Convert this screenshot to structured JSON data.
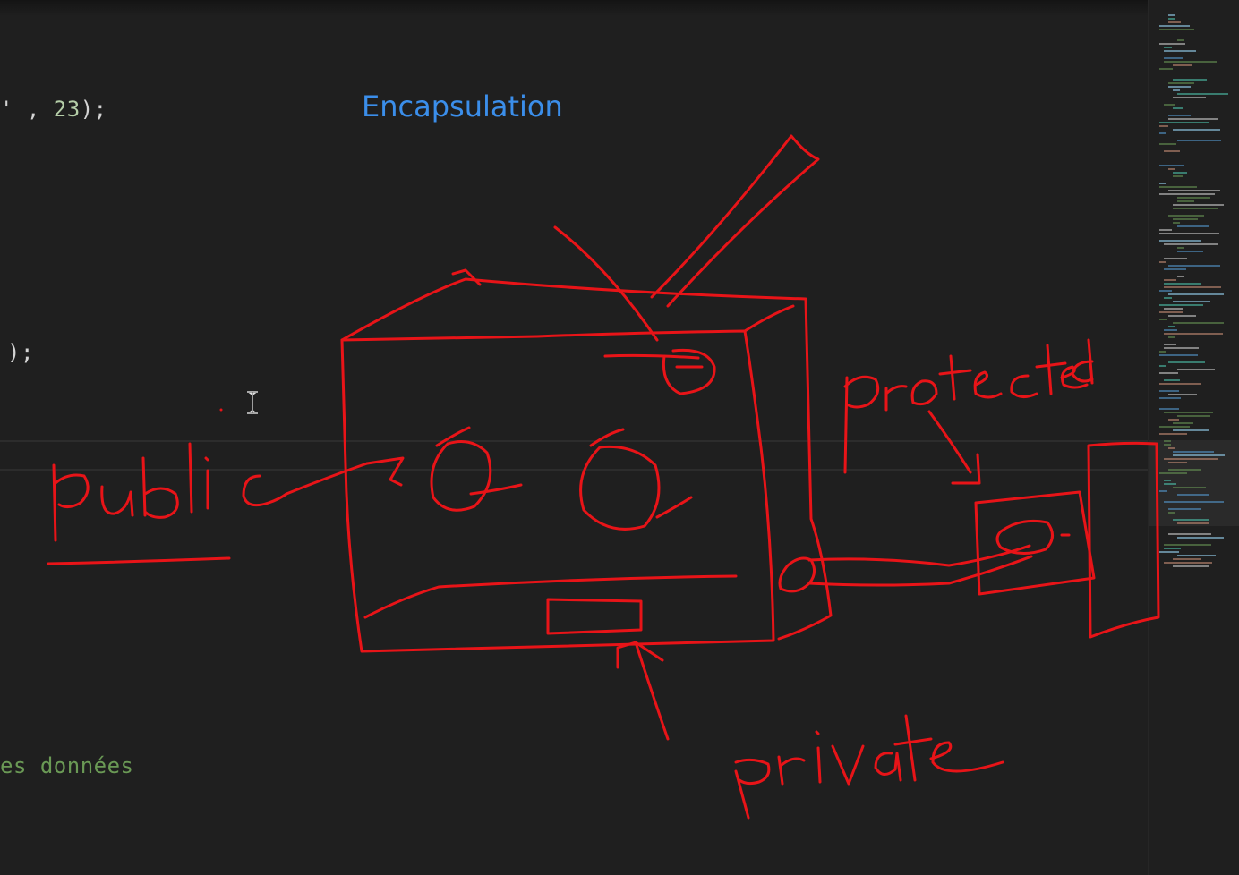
{
  "editor": {
    "code_lines": [
      {
        "prefix": "' , ",
        "number": "23",
        "suffix": ");"
      },
      {
        "text": ");"
      }
    ],
    "comment_line": "es données"
  },
  "annotation": {
    "title": "Encapsulation",
    "labels": {
      "public": "public",
      "protected": "protected",
      "private": "private"
    },
    "ink_color": "#e81418",
    "title_color": "#3b8eea"
  },
  "icons": {
    "cursor": "text-cursor-icon"
  }
}
